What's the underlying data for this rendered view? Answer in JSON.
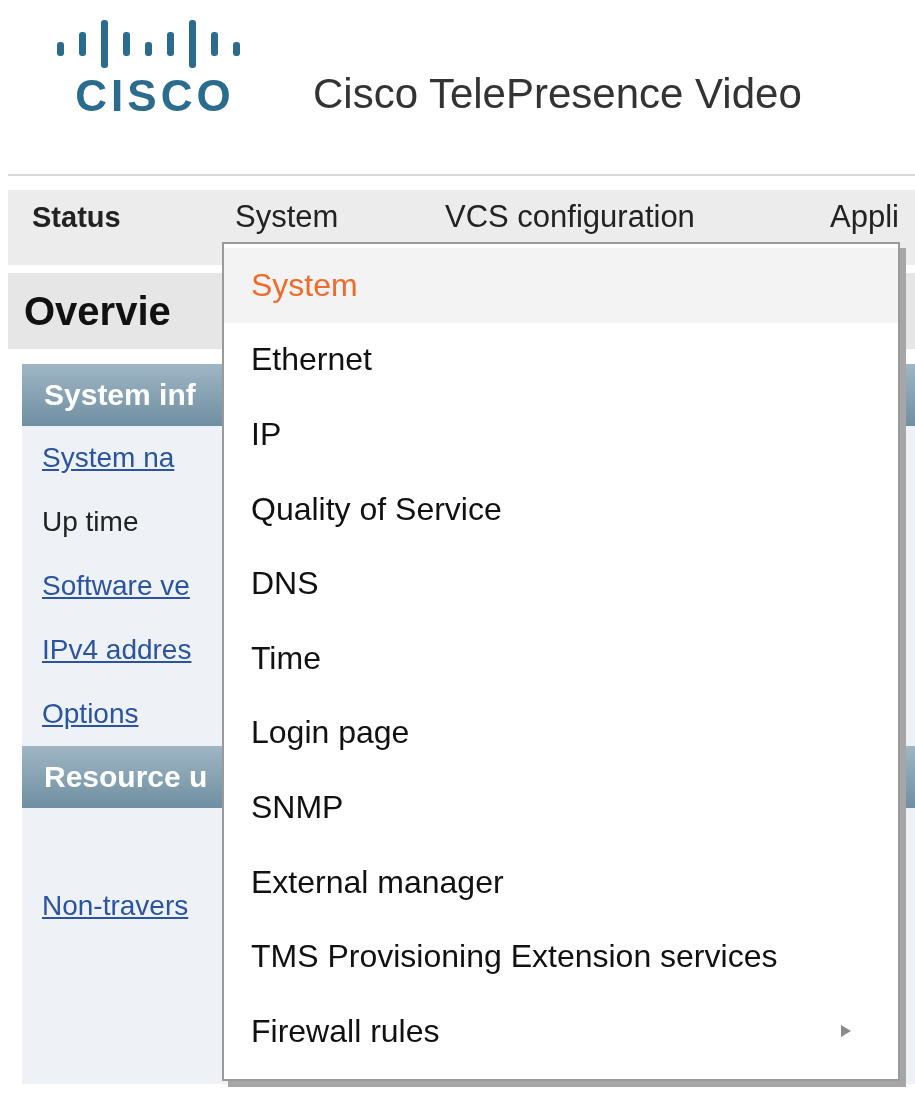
{
  "header": {
    "logo": "CISCO",
    "title": "Cisco TelePresence Video"
  },
  "nav": [
    {
      "label": "Status",
      "selected": true
    },
    {
      "label": "System",
      "selected": false
    },
    {
      "label": "VCS configuration",
      "selected": false
    },
    {
      "label": "Appli",
      "selected": false
    }
  ],
  "page_title": "Overvie",
  "sections": [
    {
      "title": "System inf",
      "rows": [
        {
          "label": "System na",
          "link": true
        },
        {
          "label": "Up time",
          "link": false
        },
        {
          "label": "Software ve",
          "link": true
        },
        {
          "label": "IPv4 addres",
          "link": true
        },
        {
          "label": "Options",
          "link": true
        }
      ]
    },
    {
      "title": "Resource u",
      "rows": [
        {
          "label": "Non-travers",
          "link": true
        }
      ]
    }
  ],
  "menu": {
    "items": [
      {
        "label": "System",
        "selected": true,
        "kind": "item"
      },
      {
        "label": "Ethernet",
        "selected": false,
        "kind": "item"
      },
      {
        "label": "IP",
        "selected": false,
        "kind": "item"
      },
      {
        "label": "Quality of Service",
        "selected": false,
        "kind": "item"
      },
      {
        "label": "DNS",
        "selected": false,
        "kind": "item"
      },
      {
        "label": "Time",
        "selected": false,
        "kind": "item"
      },
      {
        "label": "Login page",
        "selected": false,
        "kind": "item"
      },
      {
        "label": "SNMP",
        "selected": false,
        "kind": "item"
      },
      {
        "label": "External manager",
        "selected": false,
        "kind": "item"
      },
      {
        "label": "TMS Provisioning Extension services",
        "selected": false,
        "kind": "item"
      },
      {
        "label": "Firewall rules",
        "selected": false,
        "kind": "submenu"
      }
    ]
  }
}
